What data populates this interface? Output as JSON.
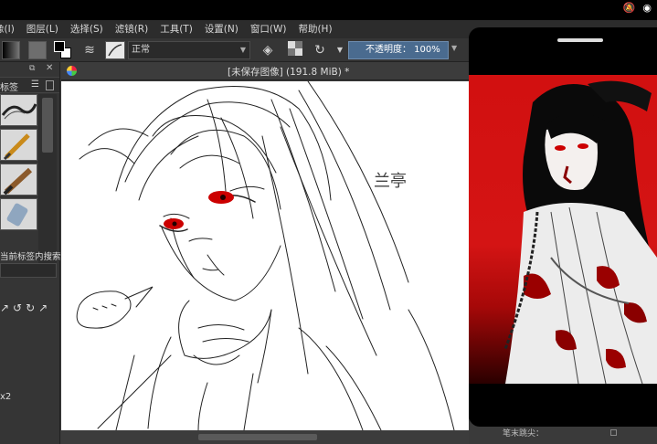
{
  "status_bar": {
    "icons": [
      "mute-icon",
      "wifi-icon"
    ]
  },
  "menu": {
    "items": [
      "像(I)",
      "图层(L)",
      "选择(S)",
      "滤镜(R)",
      "工具(T)",
      "设置(N)",
      "窗口(W)",
      "帮助(H)"
    ]
  },
  "toolbar": {
    "blend_mode": "正常",
    "opacity_label": "不透明度： 100%"
  },
  "left_dock": {
    "tags_label": "标签",
    "tag_search_label": "当前标签内搜索",
    "zoom_label": "x2"
  },
  "document": {
    "title": "[未保存图像]  (191.8 MiB)  *"
  },
  "canvas": {
    "signature": "兰亭"
  },
  "right_panel": {
    "footer_label": "笔末跳尖："
  },
  "colors": {
    "accent": "#4a6b8f",
    "foreground": "#000000",
    "background": "#ffffff",
    "eye_red": "#d01010"
  }
}
